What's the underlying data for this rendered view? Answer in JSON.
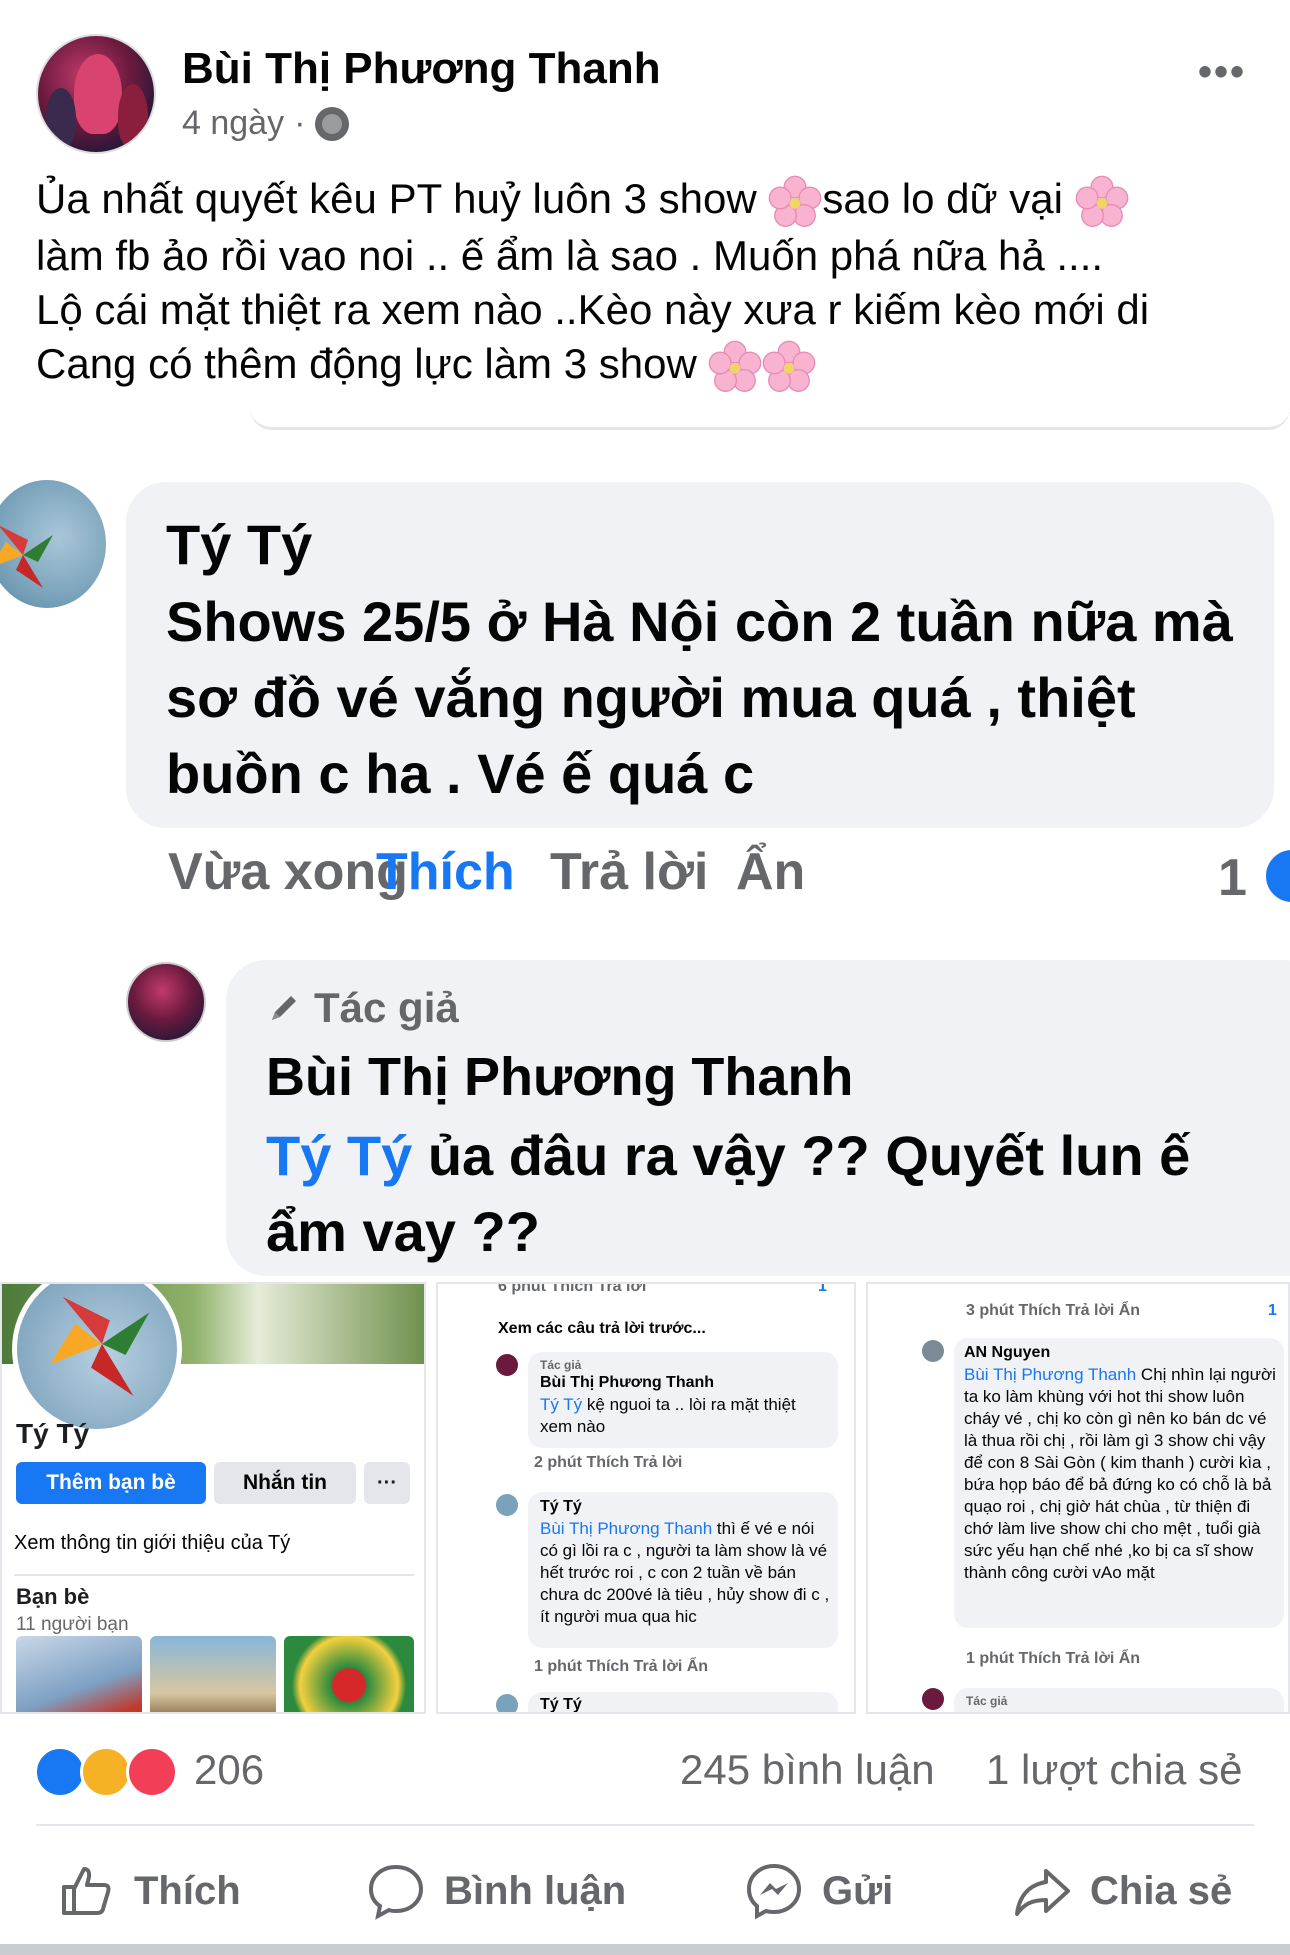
{
  "post": {
    "author": "Bùi Thị Phương Thanh",
    "time": "4 ngày",
    "dot": "·",
    "more": "•••",
    "lines": [
      "Ủa nhất quyết kêu PT huỷ luôn 3 show",
      "sao lo dữ vại",
      "làm fb ảo rồi vao noi  .. ế ẩm là sao .  Muốn phá nữa hả ....",
      "Lộ cái mặt thiệt ra xem nào ..Kèo này xưa r kiếm kèo mới di",
      "Cang có thêm động lực làm 3 show"
    ]
  },
  "comment1": {
    "name": "Tý Tý",
    "text": "Shows 25/5 ở Hà Nội còn 2 tuần nữa mà sơ đồ vé vắng người mua quá , thiệt buồn c ha . Vé ế quá c",
    "time": "Vừa xong",
    "like": "Thích",
    "reply": "Trả lời",
    "hide": "Ẩn",
    "reactions": "1"
  },
  "comment2": {
    "tag": "Tác giả",
    "name": "Bùi Thị Phương Thanh",
    "mention": "Tý Tý",
    "text": " ủa đâu ra vậy ?? Quyết lun ế ẩm vay ??"
  },
  "collage": {
    "profile": {
      "name": "Tý Tý",
      "add_friend": "Thêm bạn bè",
      "message": "Nhắn tin",
      "more": "···",
      "intro": "Xem thông tin giới thiệu của Tý",
      "friends_label": "Bạn bè",
      "friends_count": "11 người bạn"
    },
    "middle": {
      "top_meta": "6 phút   Thích   Trả lời",
      "top_count": "1",
      "see_prev": "Xem các câu trả lời trước...",
      "c1_tag": "Tác giả",
      "c1_name": "Bùi Thị Phương Thanh",
      "c1_mention": "Tý Tý",
      "c1_text": " kệ nguoi ta .. lòi ra mặt thiệt xem nào",
      "c1_meta": "2 phút    Thích    Trả lời",
      "c2_name": "Tý Tý",
      "c2_mention": "Bùi Thị Phương Thanh",
      "c2_text": " thì ế vé e nói có gì lồi ra c , người ta làm show là vé hết trước roi , c con 2 tuần về bán chưa dc 200vé là tiêu , hủy show đi c , ít người mua qua hic",
      "c2_meta": "1 phút    Thích    Trả lời    Ẩn",
      "c3_name": "Tý Tý"
    },
    "right": {
      "top_meta": "3 phút    Thích    Trả lời    Ẩn",
      "top_count": "1",
      "c_name": "AN Nguyen",
      "c_mention": "Bùi Thị Phương Thanh",
      "c_text": " Chị nhìn lại người ta ko làm khùng với hot thi show luôn cháy vé , chị ko còn gì nên ko bán dc vé là thua rồi chị , rồi làm gì 3 show chi vậy để con 8 Sài Gòn ( kim thanh ) cười kìa , bứa họp báo để bả đứng ko có chỗ là bả quạo roi , chị giờ hát chùa , từ thiện đi chớ làm live show chi cho mệt , tuổi già sức yếu hạn chế nhé ,ko bị ca sĩ show thành công cười vAo mặt",
      "c_meta": "1 phút    Thích    Trả lời    Ẩn",
      "bottom_tag": "Tác giả"
    }
  },
  "stats": {
    "reactions_total": "206",
    "comments": "245 bình luận",
    "shares": "1 lượt chia sẻ"
  },
  "actions": {
    "like": "Thích",
    "comment": "Bình luận",
    "send": "Gửi",
    "share": "Chia sẻ"
  },
  "colors": {
    "accent": "#1877f2",
    "muted": "#65676b",
    "bubble": "#f0f2f5"
  }
}
